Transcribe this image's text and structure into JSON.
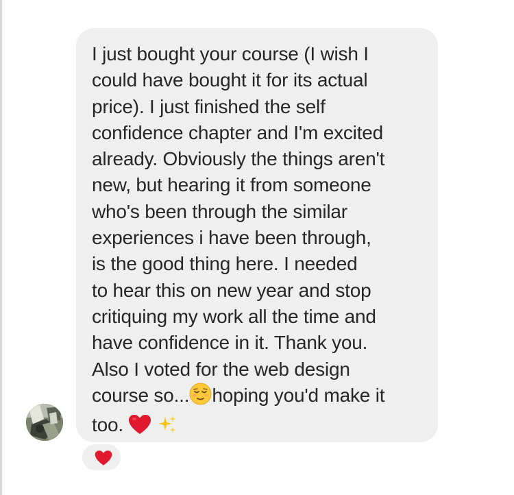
{
  "conversation": {
    "message": {
      "lines": [
        "I just bought your course (I wish I",
        "could have bought it for its actual",
        "price). I just finished the self",
        "confidence chapter and I'm excited",
        "already. Obviously the things aren't",
        "new, but hearing it from someone",
        "who's been through the similar",
        "experiences i have been through,",
        "is the good thing here. I needed",
        "to hear this on new year and stop",
        "critiquing my work all the time and",
        "have confidence in it. Thank you.",
        "Also I voted for the web design"
      ],
      "line14_before_emoji": "course so...",
      "line14_after_emoji": "hoping you'd make it",
      "line15": "too. "
    },
    "icons": {
      "sender_avatar": "avatar",
      "relieved_face": "relieved-face-icon",
      "red_heart": "red-heart-icon",
      "sparkles": "sparkles-icon",
      "reaction_heart": "red-heart-icon"
    },
    "colors": {
      "bubble": "#efefef",
      "text": "#262626",
      "heart": "#e0192e",
      "sparkle": "#f5c518"
    }
  }
}
